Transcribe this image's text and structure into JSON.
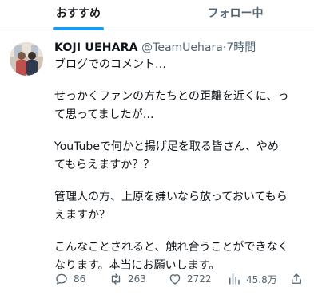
{
  "tabs": {
    "recommended": "おすすめ",
    "following": "フォロー中"
  },
  "tweet": {
    "author_name": "KOJI UEHARA",
    "handle": "@TeamUehara",
    "separator": "·",
    "time": "7時間",
    "lines": [
      "ブログでのコメント…",
      "",
      "せっかくファンの方たちとの距離を近くに、っ",
      "て思ってましたが…",
      "",
      "YouTubeで何かと揚げ足を取る皆さん、やめ",
      "てもらえますか？？",
      "",
      "管理人の方、上原を嫌いなら放っておいてもら",
      "えますか？",
      "",
      "こんなことされると、触れ合うことができなく",
      "なります。本当にお願いします。"
    ]
  },
  "actions": {
    "replies": "86",
    "retweets": "263",
    "likes": "2722",
    "views": "45.8万"
  },
  "colors": {
    "accent": "#1d9bf0",
    "secondary_text": "#536471"
  },
  "icons": {
    "reply": "reply-icon",
    "retweet": "retweet-icon",
    "like": "heart-icon",
    "views": "views-chart-icon",
    "share": "share-icon"
  }
}
